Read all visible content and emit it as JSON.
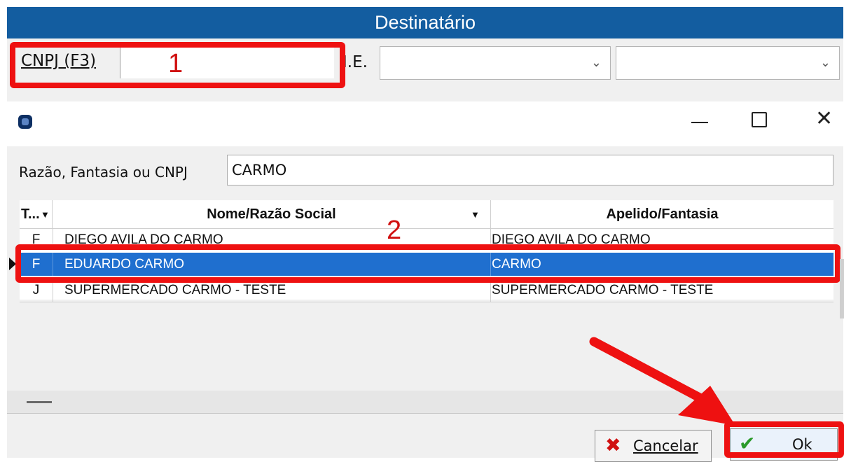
{
  "header": {
    "title": "Destinatário"
  },
  "form": {
    "cnpj_label": "CNPJ (F3)",
    "cnpj_value": "",
    "ie_label": "I.E.",
    "ie_value": "",
    "combo2_value": ""
  },
  "annotations": {
    "step1": "1",
    "step2": "2"
  },
  "dialog": {
    "search_label": "Razão, Fantasia ou CNPJ",
    "search_value": "CARMO",
    "grid": {
      "columns": [
        "T...",
        "Nome/Razão Social",
        "Apelido/Fantasia"
      ],
      "rows": [
        {
          "type": "F",
          "name": "DIEGO AVILA DO CARMO",
          "alias": "DIEGO AVILA DO CARMO"
        },
        {
          "type": "F",
          "name": "EDUARDO CARMO",
          "alias": "CARMO"
        },
        {
          "type": "J",
          "name": "SUPERMERCADO CARMO - TESTE",
          "alias": "SUPERMERCADO CARMO - TESTE"
        }
      ],
      "selected_row": 1
    },
    "buttons": {
      "cancel_label": "Cancelar",
      "ok_label": "Ok"
    }
  },
  "colors": {
    "header_bg": "#135da0",
    "selection_bg": "#1f6fcf",
    "annotation_red": "#ee1111"
  },
  "icons": [
    "chevron-down-icon",
    "app-icon",
    "minimize-icon",
    "maximize-icon",
    "close-icon",
    "sort-down-icon",
    "row-indicator-icon",
    "cancel-x-icon",
    "checkmark-icon"
  ]
}
